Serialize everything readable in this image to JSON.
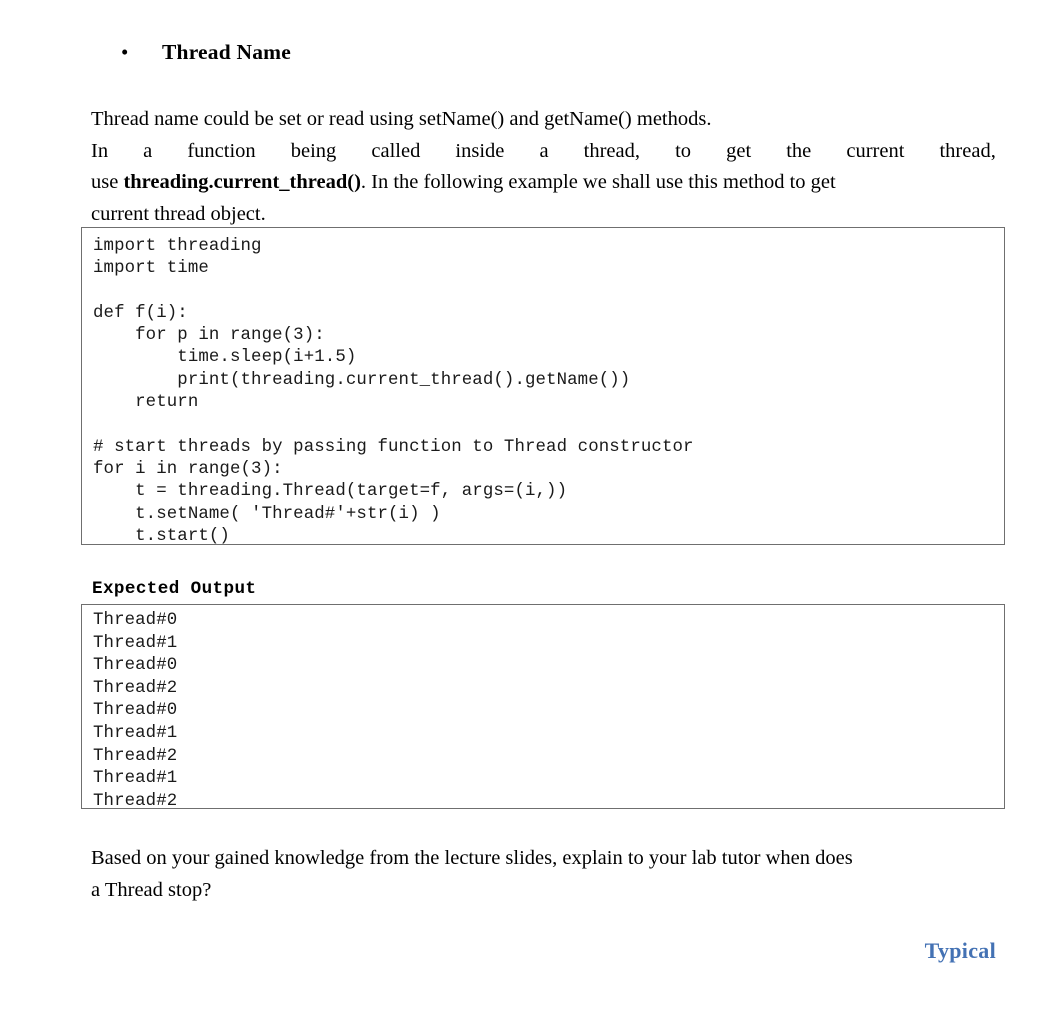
{
  "document": {
    "clipped_top_line": "",
    "heading": {
      "bullet_glyph": "•",
      "label": "Thread Name"
    },
    "intro_paragraph": {
      "line1": "Thread name could be set or read using setName() and getName() methods.",
      "line2_words": [
        "In",
        "a",
        "function",
        "being",
        "called",
        "inside",
        "a",
        "thread,",
        "to",
        "get",
        "the",
        "current",
        "thread,"
      ],
      "line3_prefix": "use ",
      "line3_bold": "threading.current_thread()",
      "line3_suffix": ". In the following example we shall use this method to get",
      "line4": "current thread object."
    },
    "code_block": {
      "language": "python",
      "content": "import threading\nimport time\n\ndef f(i):\n    for p in range(3):\n        time.sleep(i+1.5)\n        print(threading.current_thread().getName())\n    return\n\n# start threads by passing function to Thread constructor\nfor i in range(3):\n    t = threading.Thread(target=f, args=(i,))\n    t.setName( 'Thread#'+str(i) )\n    t.start()"
    },
    "expected_output": {
      "label": "Expected Output",
      "lines": [
        "Thread#0",
        "Thread#1",
        "Thread#0",
        "Thread#2",
        "Thread#0",
        "Thread#1",
        "Thread#2",
        "Thread#1",
        "Thread#2"
      ],
      "content": "Thread#0\nThread#1\nThread#0\nThread#2\nThread#0\nThread#1\nThread#2\nThread#1\nThread#2"
    },
    "closing_question": {
      "line1": "Based on your gained knowledge from the lecture slides, explain to your lab tutor when does",
      "line2": "a Thread stop?"
    },
    "footer": {
      "word": "Typical",
      "color": "#4472b4"
    },
    "colors": {
      "text": "#000000",
      "code_text": "#1a1a1a",
      "box_border": "#6f6f6f",
      "accent_blue": "#4472b4",
      "background": "#ffffff"
    }
  }
}
